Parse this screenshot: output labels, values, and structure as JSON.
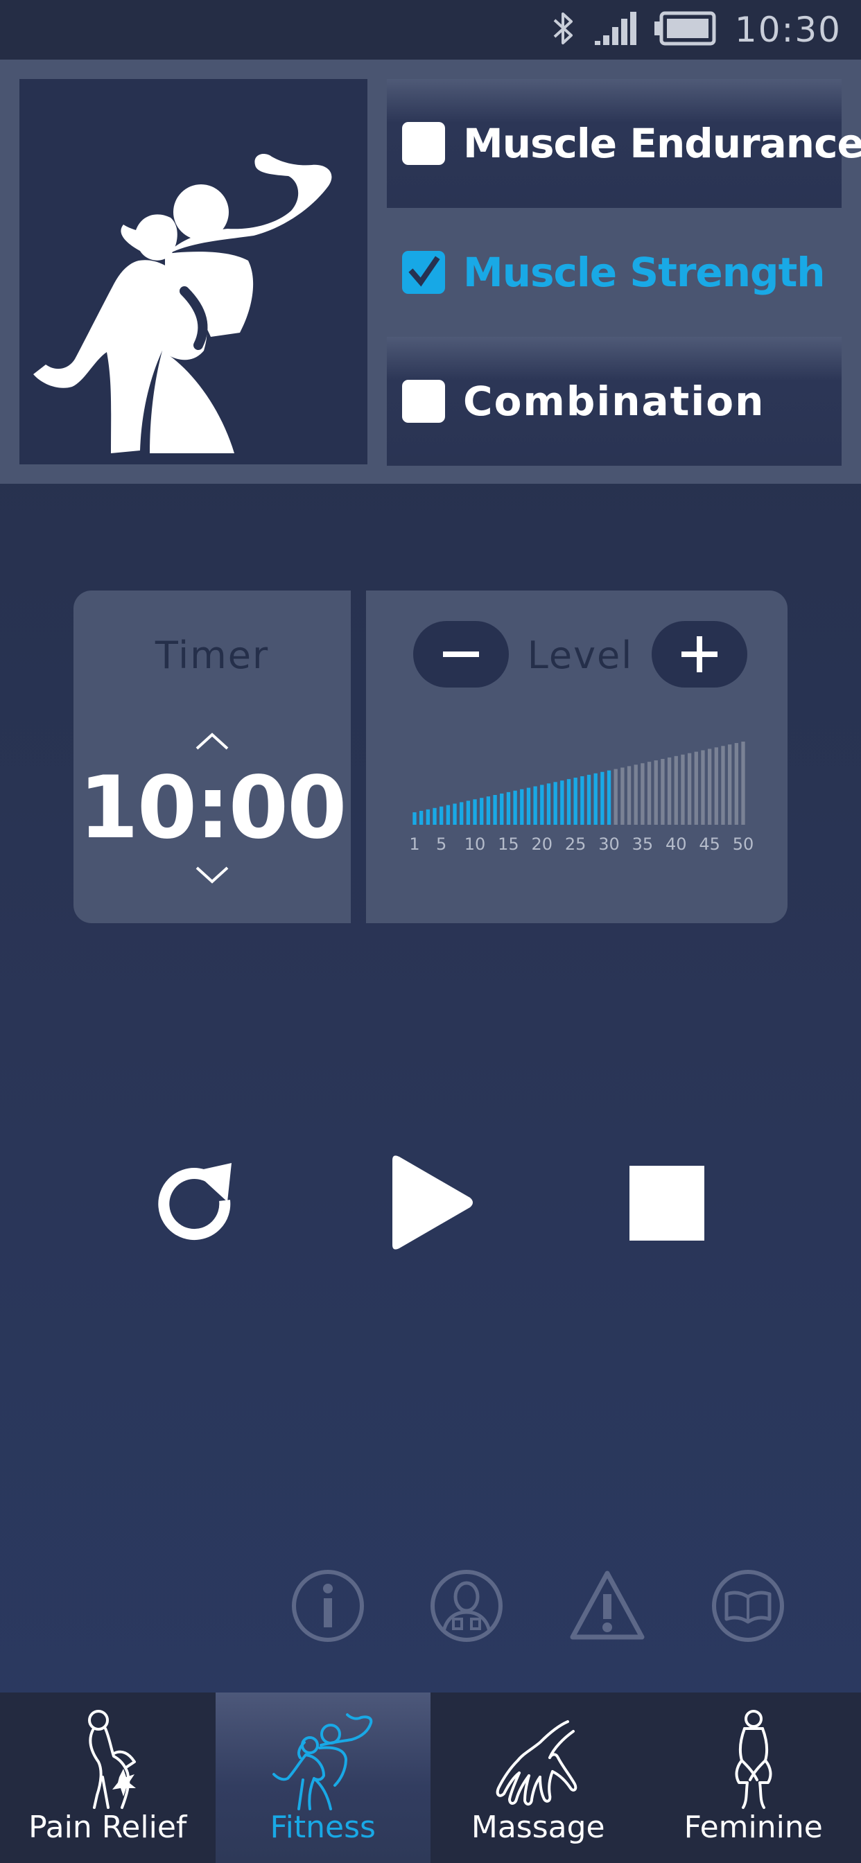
{
  "status_bar": {
    "time": "10:30",
    "icons": [
      "bluetooth-icon",
      "signal-icon",
      "battery-icon"
    ]
  },
  "modes": {
    "items": [
      {
        "label": "Muscle Endurance",
        "checked": false
      },
      {
        "label": "Muscle Strength",
        "checked": true
      },
      {
        "label": "Combination",
        "checked": false
      }
    ],
    "hero_icon": "fitness-couple-icon"
  },
  "timer": {
    "title": "Timer",
    "value": "10:00"
  },
  "level": {
    "title": "Level",
    "current": 30,
    "max": 50,
    "scale_labels": [
      "1",
      "5",
      "10",
      "15",
      "20",
      "25",
      "30",
      "35",
      "40",
      "45",
      "50"
    ]
  },
  "playback": {
    "icons": [
      "restart-icon",
      "play-icon",
      "stop-icon"
    ]
  },
  "info_row": {
    "icons": [
      "info-icon",
      "user-pads-icon",
      "warning-icon",
      "manual-book-icon"
    ]
  },
  "bottom_nav": {
    "items": [
      {
        "label": "Pain Relief",
        "icon": "pain-relief-icon",
        "active": false
      },
      {
        "label": "Fitness",
        "icon": "fitness-icon",
        "active": true
      },
      {
        "label": "Massage",
        "icon": "massage-icon",
        "active": false
      },
      {
        "label": "Feminine",
        "icon": "feminine-icon",
        "active": false
      }
    ]
  },
  "colors": {
    "accent": "#19a9e6",
    "panel": "#4a5571",
    "background": "#2a3556",
    "inactive_bar": "#7a8295"
  }
}
